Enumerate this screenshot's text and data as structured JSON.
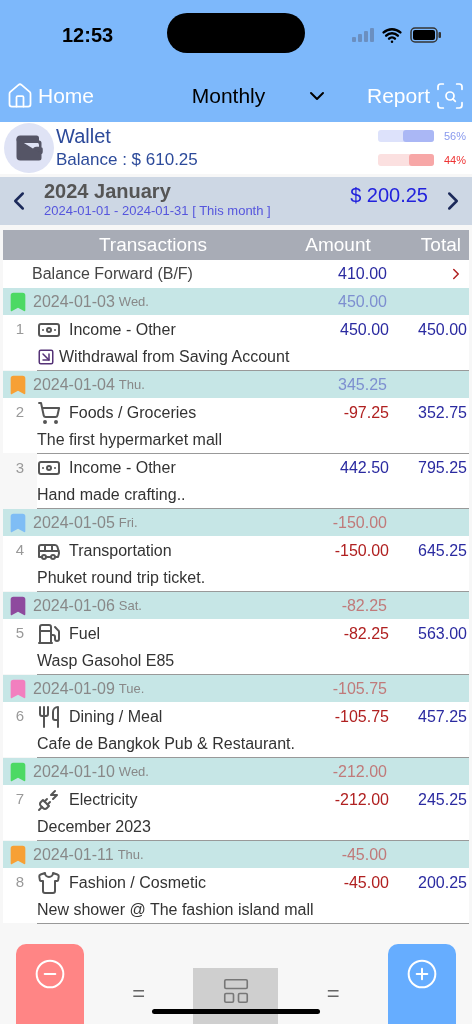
{
  "status_bar": {
    "time": "12:53"
  },
  "nav": {
    "home": "Home",
    "period": "Monthly",
    "report": "Report"
  },
  "wallet": {
    "name": "Wallet",
    "balance": "Balance : $ 610.25",
    "bars": [
      {
        "kind": "plus",
        "level": 0.56,
        "percent": "56%"
      },
      {
        "kind": "minus",
        "level": 0.44,
        "percent": "44%"
      }
    ]
  },
  "month": {
    "title": "2024 January",
    "range": "2024-01-01 - 2024-01-31 [ This month ]",
    "total": "$ 200.25"
  },
  "table": {
    "columns": [
      "Transactions",
      "Amount",
      "Total"
    ],
    "forward": {
      "label": "Balance Forward (B/F)",
      "amount": "410.00"
    },
    "days": [
      {
        "kind": "income",
        "date": "2024-01-03",
        "weekday": "Wed.",
        "sum": "450.00",
        "color": "#4cd964",
        "items": [
          {
            "kind": "money",
            "no": "1",
            "category": "Income - Other",
            "amount": "450.00",
            "total": "450.00",
            "memo": "Withdrawal from Saving Account",
            "transfer": true
          }
        ]
      },
      {
        "kind": "income",
        "date": "2024-01-04",
        "weekday": "Thu.",
        "sum": "345.25",
        "color": "#f7a035",
        "items": [
          {
            "kind": "cart",
            "no": "2",
            "category": "Foods / Groceries",
            "amount": "-97.25",
            "total": "352.75",
            "memo": "The first hypermarket mall",
            "transfer": false
          },
          {
            "kind": "money",
            "no": "3",
            "category": "Income - Other",
            "amount": "442.50",
            "total": "795.25",
            "memo": "Hand made crafting..",
            "transfer": false
          }
        ]
      },
      {
        "kind": "expense",
        "date": "2024-01-05",
        "weekday": "Fri.",
        "sum": "-150.00",
        "color": "#7fbdf5",
        "items": [
          {
            "kind": "bus",
            "no": "4",
            "category": "Transportation",
            "amount": "-150.00",
            "total": "645.25",
            "memo": "Phuket round trip ticket.",
            "transfer": false
          }
        ]
      },
      {
        "kind": "expense",
        "date": "2024-01-06",
        "weekday": "Sat.",
        "sum": "-82.25",
        "color": "#8e4a9e",
        "items": [
          {
            "kind": "fuel",
            "no": "5",
            "category": "Fuel",
            "amount": "-82.25",
            "total": "563.00",
            "memo": "Wasp Gasohol E85",
            "transfer": false
          }
        ]
      },
      {
        "kind": "expense",
        "date": "2024-01-09",
        "weekday": "Tue.",
        "sum": "-105.75",
        "color": "#f27fbf",
        "items": [
          {
            "kind": "dining",
            "no": "6",
            "category": "Dining / Meal",
            "amount": "-105.75",
            "total": "457.25",
            "memo": "Cafe de Bangkok Pub & Restaurant.",
            "transfer": false
          }
        ]
      },
      {
        "kind": "expense",
        "date": "2024-01-10",
        "weekday": "Wed.",
        "sum": "-212.00",
        "color": "#4cd964",
        "items": [
          {
            "kind": "plug",
            "no": "7",
            "category": "Electricity",
            "amount": "-212.00",
            "total": "245.25",
            "memo": "December 2023",
            "transfer": false
          }
        ]
      },
      {
        "kind": "expense",
        "date": "2024-01-11",
        "weekday": "Thu.",
        "sum": "-45.00",
        "color": "#f7a035",
        "items": [
          {
            "kind": "shirt",
            "no": "8",
            "category": "Fashion / Cosmetic",
            "amount": "-45.00",
            "total": "200.25",
            "memo": "New shower @ The fashion island mall",
            "transfer": false
          }
        ]
      }
    ]
  },
  "toolbar": {
    "left": "=",
    "right": "="
  }
}
